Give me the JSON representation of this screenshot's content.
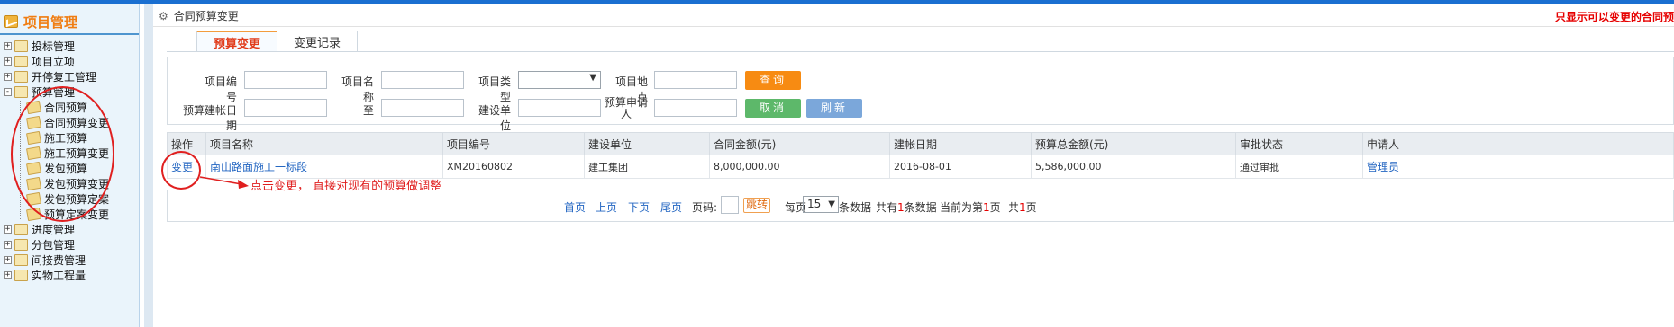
{
  "sidebar": {
    "title": "项目管理",
    "items": [
      {
        "label": "投标管理",
        "toggle": "+"
      },
      {
        "label": "项目立项",
        "toggle": "+"
      },
      {
        "label": "开停复工管理",
        "toggle": "+"
      },
      {
        "label": "预算管理",
        "toggle": "-"
      },
      {
        "label": "合同预算"
      },
      {
        "label": "合同预算变更"
      },
      {
        "label": "施工预算"
      },
      {
        "label": "施工预算变更"
      },
      {
        "label": "发包预算"
      },
      {
        "label": "发包预算变更"
      },
      {
        "label": "发包预算定案"
      },
      {
        "label": "预算定案变更"
      },
      {
        "label": "进度管理",
        "toggle": "+"
      },
      {
        "label": "分包管理",
        "toggle": "+"
      },
      {
        "label": "间接费管理",
        "toggle": "+"
      },
      {
        "label": "实物工程量",
        "toggle": "+"
      }
    ]
  },
  "header": {
    "title": "合同预算变更",
    "notice": "只显示可以变更的合同预"
  },
  "tabs": [
    {
      "label": "预算变更",
      "active": true
    },
    {
      "label": "变更记录",
      "active": false
    }
  ],
  "filter": {
    "project_code_label": "项目编号",
    "project_name_label": "项目名称",
    "project_type_label": "项目类型",
    "project_site_label": "项目地点",
    "budget_date_label": "预算建帐日期",
    "to_label": "至",
    "build_unit_label": "建设单位",
    "applicant_label": "预算申请人",
    "query_label": "查询",
    "cancel_label": "取消",
    "refresh_label": "刷新"
  },
  "table": {
    "headers": [
      "操作",
      "项目名称",
      "项目编号",
      "建设单位",
      "合同金额(元)",
      "建帐日期",
      "预算总金额(元)",
      "审批状态",
      "申请人"
    ],
    "rows": [
      {
        "action": "变更",
        "name": "南山路面施工一标段",
        "code": "XM20160802",
        "unit": "建工集团",
        "amount": "8,000,000.00",
        "date": "2016-08-01",
        "budget": "5,586,000.00",
        "status": "通过审批",
        "applicant": "管理员"
      }
    ]
  },
  "pager": {
    "first": "首页",
    "prev": "上页",
    "next": "下页",
    "last": "尾页",
    "page_label": "页码:",
    "jump": "跳转",
    "per_page_prefix": "每页",
    "per_page": "15",
    "per_page_suffix": "条数据",
    "total_prefix": "共有",
    "total_count": "1",
    "total_suffix": "条数据",
    "current_prefix": "当前为第",
    "current_page": "1",
    "current_suffix": "页",
    "pages_prefix": "共",
    "pages_count": "1",
    "pages_suffix": "页"
  },
  "annotation": "点击变更， 直接对现有的预算做调整",
  "colors": {
    "accent": "#1a6fd1",
    "annotation_red": "#e01f1f",
    "link": "#2366c2"
  }
}
